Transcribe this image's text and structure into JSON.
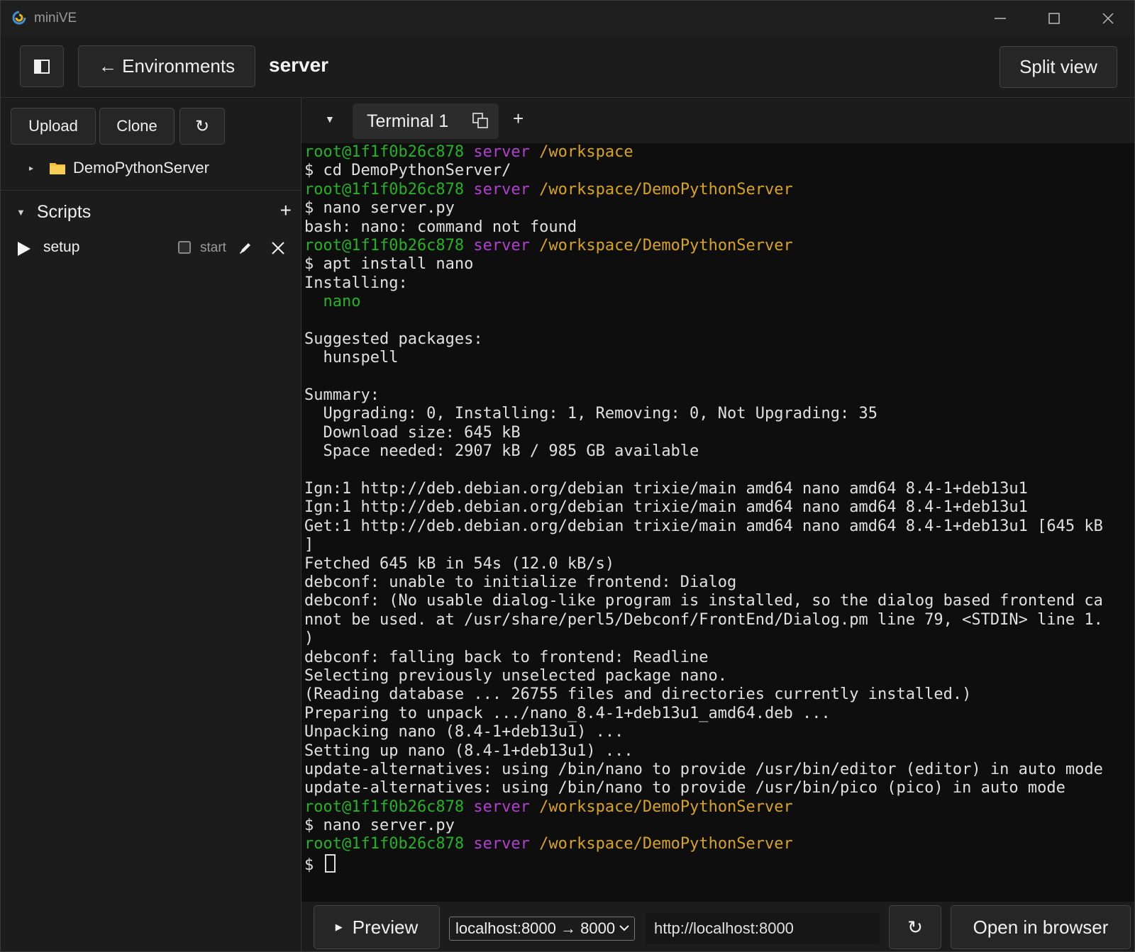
{
  "app": {
    "title": "miniVE"
  },
  "toolbar": {
    "environments_label": "← Environments",
    "environment_name": "server",
    "split_view_label": "Split view"
  },
  "sidebar": {
    "upload_label": "Upload",
    "clone_label": "Clone",
    "refresh_label": "↻",
    "tree": [
      {
        "label": "DemoPythonServer",
        "icon": "folder-icon"
      }
    ],
    "scripts_title": "Scripts",
    "scripts_add": "+",
    "scripts": [
      {
        "name": "setup",
        "start_label": "start",
        "start_checked": false
      }
    ]
  },
  "terminal": {
    "tabs": [
      {
        "label": "Terminal 1"
      }
    ],
    "add_tab": "+",
    "colors": {
      "user": "#23b323",
      "env": "#b13fd0",
      "path": "#d8a418"
    },
    "lines": [
      {
        "user": "root@1f1f0b26c878",
        "env": "server",
        "path": "/workspace"
      },
      {
        "text": "$ cd DemoPythonServer/"
      },
      {
        "user": "root@1f1f0b26c878",
        "env": "server",
        "path": "/workspace/DemoPythonServer"
      },
      {
        "text": "$ nano server.py"
      },
      {
        "text": "bash: nano: command not found"
      },
      {
        "user": "root@1f1f0b26c878",
        "env": "server",
        "path": "/workspace/DemoPythonServer"
      },
      {
        "text": "$ apt install nano"
      },
      {
        "text": "Installing:"
      },
      {
        "text": "  nano",
        "color": "green"
      },
      {
        "text": ""
      },
      {
        "text": "Suggested packages:"
      },
      {
        "text": "  hunspell"
      },
      {
        "text": ""
      },
      {
        "text": "Summary:"
      },
      {
        "text": "  Upgrading: 0, Installing: 1, Removing: 0, Not Upgrading: 35"
      },
      {
        "text": "  Download size: 645 kB"
      },
      {
        "text": "  Space needed: 2907 kB / 985 GB available"
      },
      {
        "text": ""
      },
      {
        "text": "Ign:1 http://deb.debian.org/debian trixie/main amd64 nano amd64 8.4-1+deb13u1"
      },
      {
        "text": "Ign:1 http://deb.debian.org/debian trixie/main amd64 nano amd64 8.4-1+deb13u1"
      },
      {
        "text": "Get:1 http://deb.debian.org/debian trixie/main amd64 nano amd64 8.4-1+deb13u1 [645 kB"
      },
      {
        "text": "]"
      },
      {
        "text": "Fetched 645 kB in 54s (12.0 kB/s)"
      },
      {
        "text": "debconf: unable to initialize frontend: Dialog"
      },
      {
        "text": "debconf: (No usable dialog-like program is installed, so the dialog based frontend ca"
      },
      {
        "text": "nnot be used. at /usr/share/perl5/Debconf/FrontEnd/Dialog.pm line 79, <STDIN> line 1."
      },
      {
        "text": ")"
      },
      {
        "text": "debconf: falling back to frontend: Readline"
      },
      {
        "text": "Selecting previously unselected package nano."
      },
      {
        "text": "(Reading database ... 26755 files and directories currently installed.)"
      },
      {
        "text": "Preparing to unpack .../nano_8.4-1+deb13u1_amd64.deb ..."
      },
      {
        "text": "Unpacking nano (8.4-1+deb13u1) ..."
      },
      {
        "text": "Setting up nano (8.4-1+deb13u1) ..."
      },
      {
        "text": "update-alternatives: using /bin/nano to provide /usr/bin/editor (editor) in auto mode"
      },
      {
        "text": "update-alternatives: using /bin/nano to provide /usr/bin/pico (pico) in auto mode"
      },
      {
        "user": "root@1f1f0b26c878",
        "env": "server",
        "path": "/workspace/DemoPythonServer"
      },
      {
        "text": "$ nano server.py"
      },
      {
        "user": "root@1f1f0b26c878",
        "env": "server",
        "path": "/workspace/DemoPythonServer"
      },
      {
        "text": "$ ",
        "cursor": true
      }
    ]
  },
  "bottom": {
    "preview_label": "Preview",
    "port_selected": "localhost:8000 → 8000",
    "url_value": "http://localhost:8000",
    "reload_label": "↻",
    "open_browser_label": "Open in browser"
  }
}
